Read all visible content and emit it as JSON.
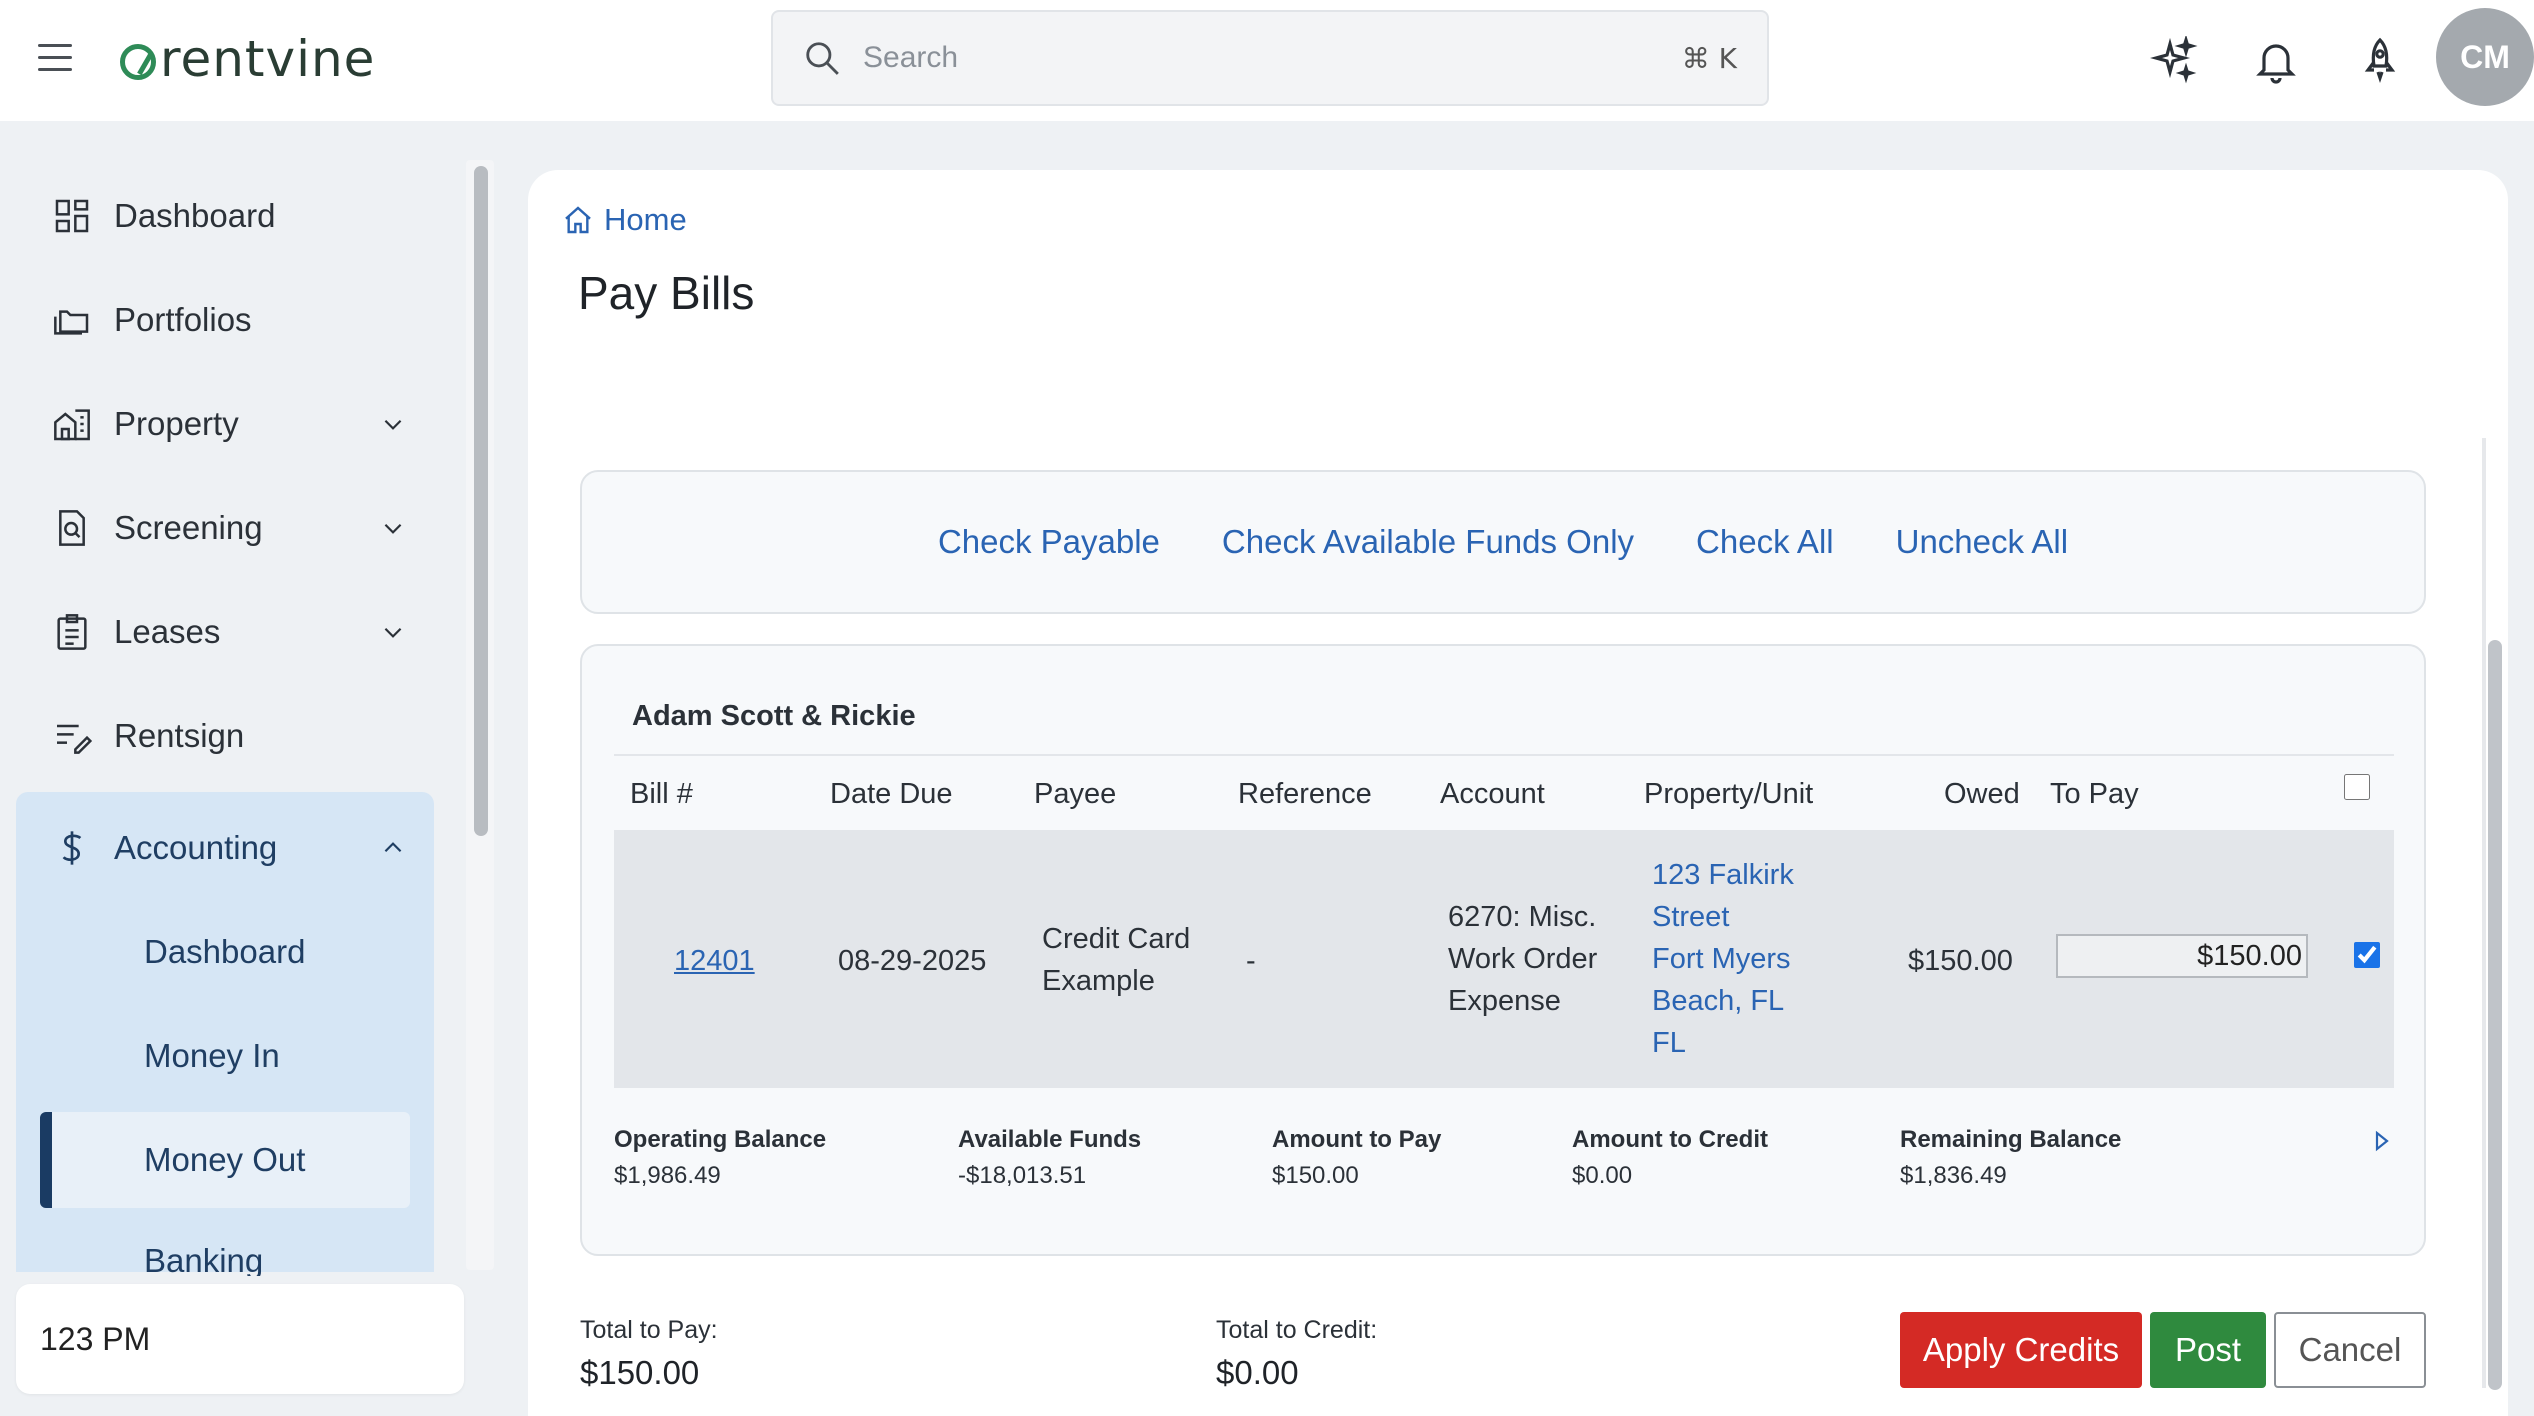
{
  "header": {
    "logo_text": "rentvine",
    "search_placeholder": "Search",
    "search_shortcut": "⌘ K",
    "avatar_initials": "CM"
  },
  "sidebar": {
    "items": [
      {
        "label": "Dashboard",
        "icon": "dashboard-grid-icon"
      },
      {
        "label": "Portfolios",
        "icon": "folders-icon"
      },
      {
        "label": "Property",
        "icon": "building-icon"
      },
      {
        "label": "Screening",
        "icon": "document-search-icon"
      },
      {
        "label": "Leases",
        "icon": "clipboard-icon"
      },
      {
        "label": "Rentsign",
        "icon": "signature-icon"
      },
      {
        "label": "Accounting",
        "icon": "dollar-icon"
      }
    ],
    "accounting_sub": [
      "Dashboard",
      "Money In",
      "Money Out",
      "Banking"
    ],
    "active_sub": "Money Out",
    "clock": "123 PM"
  },
  "main": {
    "breadcrumb": "Home",
    "title": "Pay Bills",
    "check_actions": [
      "Check Payable",
      "Check Available Funds Only",
      "Check All",
      "Uncheck All"
    ],
    "vendor": "Adam Scott & Rickie",
    "columns": [
      "Bill #",
      "Date Due",
      "Payee",
      "Reference",
      "Account",
      "Property/Unit",
      "Owed",
      "To Pay"
    ],
    "bill": {
      "number": "12401",
      "date_due": "08-29-2025",
      "payee_line1": "Credit Card",
      "payee_line2": "Example",
      "reference": "-",
      "account_line1": "6270: Misc.",
      "account_line2": "Work Order",
      "account_line3": "Expense",
      "property_line1": "123 Falkirk",
      "property_line2": "Street",
      "property_line3": "Fort Myers",
      "property_line4": "Beach, FL",
      "property_line5": "FL",
      "owed": "$150.00",
      "to_pay": "$150.00",
      "checked": true
    },
    "summary": [
      {
        "label": "Operating Balance",
        "value": "$1,986.49"
      },
      {
        "label": "Available Funds",
        "value": "-$18,013.51"
      },
      {
        "label": "Amount to Pay",
        "value": "$150.00"
      },
      {
        "label": "Amount to Credit",
        "value": "$0.00"
      },
      {
        "label": "Remaining Balance",
        "value": "$1,836.49"
      }
    ],
    "footer": {
      "total_to_pay_label": "Total to Pay:",
      "total_to_pay": "$150.00",
      "total_to_credit_label": "Total to Credit:",
      "total_to_credit": "$0.00",
      "apply_credits": "Apply Credits",
      "post": "Post",
      "cancel": "Cancel"
    }
  },
  "colors": {
    "link": "#2a64b3",
    "apply_credits": "#d42a25",
    "post": "#2f8a3e",
    "accounting_bg": "#d6e6f5"
  }
}
